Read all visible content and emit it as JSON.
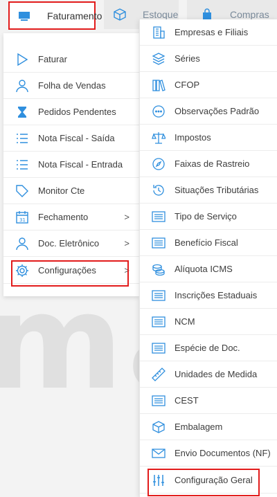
{
  "tabs": {
    "faturamento": "Faturamento",
    "estoque": "Estoque",
    "compras": "Compras"
  },
  "left_menu": [
    {
      "label": "Faturar",
      "icon": "play-icon"
    },
    {
      "label": "Folha de Vendas",
      "icon": "user-icon"
    },
    {
      "label": "Pedidos Pendentes",
      "icon": "hourglass-icon"
    },
    {
      "label": "Nota Fiscal - Saída",
      "icon": "list-icon"
    },
    {
      "label": "Nota Fiscal - Entrada",
      "icon": "list-icon"
    },
    {
      "label": "Monitor Cte",
      "icon": "tag-icon"
    },
    {
      "label": "Fechamento",
      "icon": "calendar-icon",
      "chevron": ">"
    },
    {
      "label": "Doc. Eletrônico",
      "icon": "user-icon",
      "chevron": ">"
    },
    {
      "label": "Configurações",
      "icon": "gear-icon",
      "chevron": ">"
    }
  ],
  "right_menu": [
    {
      "label": "Empresas e Filiais",
      "icon": "building-icon"
    },
    {
      "label": "Séries",
      "icon": "layers-icon"
    },
    {
      "label": "CFOP",
      "icon": "books-icon"
    },
    {
      "label": "Observações Padrão",
      "icon": "chat-icon"
    },
    {
      "label": "Impostos",
      "icon": "scale-icon"
    },
    {
      "label": "Faixas de Rastreio",
      "icon": "compass-icon"
    },
    {
      "label": "Situações Tributárias",
      "icon": "history-icon"
    },
    {
      "label": "Tipo de Serviço",
      "icon": "form-icon"
    },
    {
      "label": "Benefício Fiscal",
      "icon": "form-icon"
    },
    {
      "label": "Alíquota ICMS",
      "icon": "coins-icon"
    },
    {
      "label": "Inscrições Estaduais",
      "icon": "form-icon"
    },
    {
      "label": "NCM",
      "icon": "form-icon"
    },
    {
      "label": "Espécie de Doc.",
      "icon": "form-icon"
    },
    {
      "label": "Unidades de Medida",
      "icon": "ruler-icon"
    },
    {
      "label": "CEST",
      "icon": "form-icon"
    },
    {
      "label": "Embalagem",
      "icon": "box-icon"
    },
    {
      "label": "Envio Documentos (NF)",
      "icon": "mail-icon"
    },
    {
      "label": "Configuração Geral",
      "icon": "sliders-icon"
    }
  ],
  "colors": {
    "accent": "#2f8fde",
    "highlight": "#e21b1b"
  }
}
